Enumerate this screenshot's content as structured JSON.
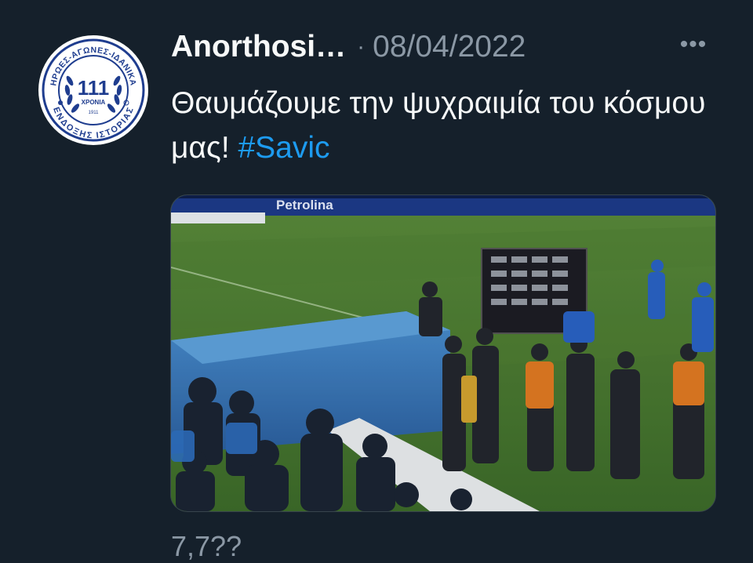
{
  "tweet": {
    "author_name": "Anorthosi…",
    "separator": "·",
    "date": "08/04/2022",
    "more_label": "•••",
    "text": "Θαυμάζουμε την ψυχραιμία του κόσμου μας! ",
    "hashtag": "#Savic",
    "media_banner_text": "Petrolina",
    "stats_partial": "7,7??"
  },
  "avatar_logo": {
    "top_arc_text": "ΗΡΩΕΣ-ΑΓΩΝΕΣ-ΙΔΑΝΙΚΑ",
    "bottom_arc_text": "ΕΝΔΟΞΗΣ ΙΣΤΟΡΙΑΣ",
    "number": "111",
    "sub_label": "ΧΡΟΝΙΑ",
    "year": "1911"
  },
  "colors": {
    "background": "#15202b",
    "hashtag": "#1d9bf0",
    "secondary_text": "#8b98a5",
    "logo_blue": "#1f3d8f"
  }
}
